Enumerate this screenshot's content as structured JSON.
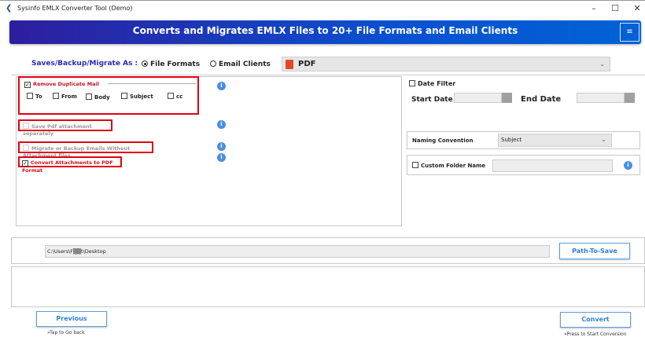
{
  "window": {
    "title": "Sysinfo EMLX Converter Tool (Demo)",
    "minimize": "–",
    "maximize": "☐",
    "close": "✕"
  },
  "banner": {
    "title": "Converts and Migrates EMLX Files to 20+ File Formats and Email Clients",
    "menu_icon": "≡"
  },
  "save_as": {
    "label": "Saves/Backup/Migrate As :",
    "option_file": "File Formats",
    "option_email": "Email Clients",
    "selected_format": "PDF"
  },
  "options": {
    "remove_duplicate": "Remove Duplicate Mail",
    "dup_fields": [
      "To",
      "From",
      "Body",
      "Subject",
      "cc"
    ],
    "save_pdf_attach": "Save Pdf attachment separately",
    "migrate_without_attach": "Migrate or Backup Emails Without Attachment files",
    "convert_attach_pdf": "Convert Attachments to PDF Format"
  },
  "filters": {
    "date_filter": "Date Filter",
    "start_date": "Start Date",
    "end_date": "End Date",
    "naming_label": "Naming Convention",
    "naming_value": "Subject",
    "custom_folder": "Custom Folder Name"
  },
  "path": {
    "value": "C:\\Users\\F▒▒t\\Desktop",
    "button": "Path-To-Save"
  },
  "footer": {
    "previous": "Previous",
    "previous_hint": "»Tap to Go back",
    "convert": "Convert",
    "convert_hint": "»Press to Start Conversion"
  },
  "colors": {
    "accent": "#2e7fd6",
    "highlight": "#e00010",
    "banner": "#0a50d0"
  }
}
